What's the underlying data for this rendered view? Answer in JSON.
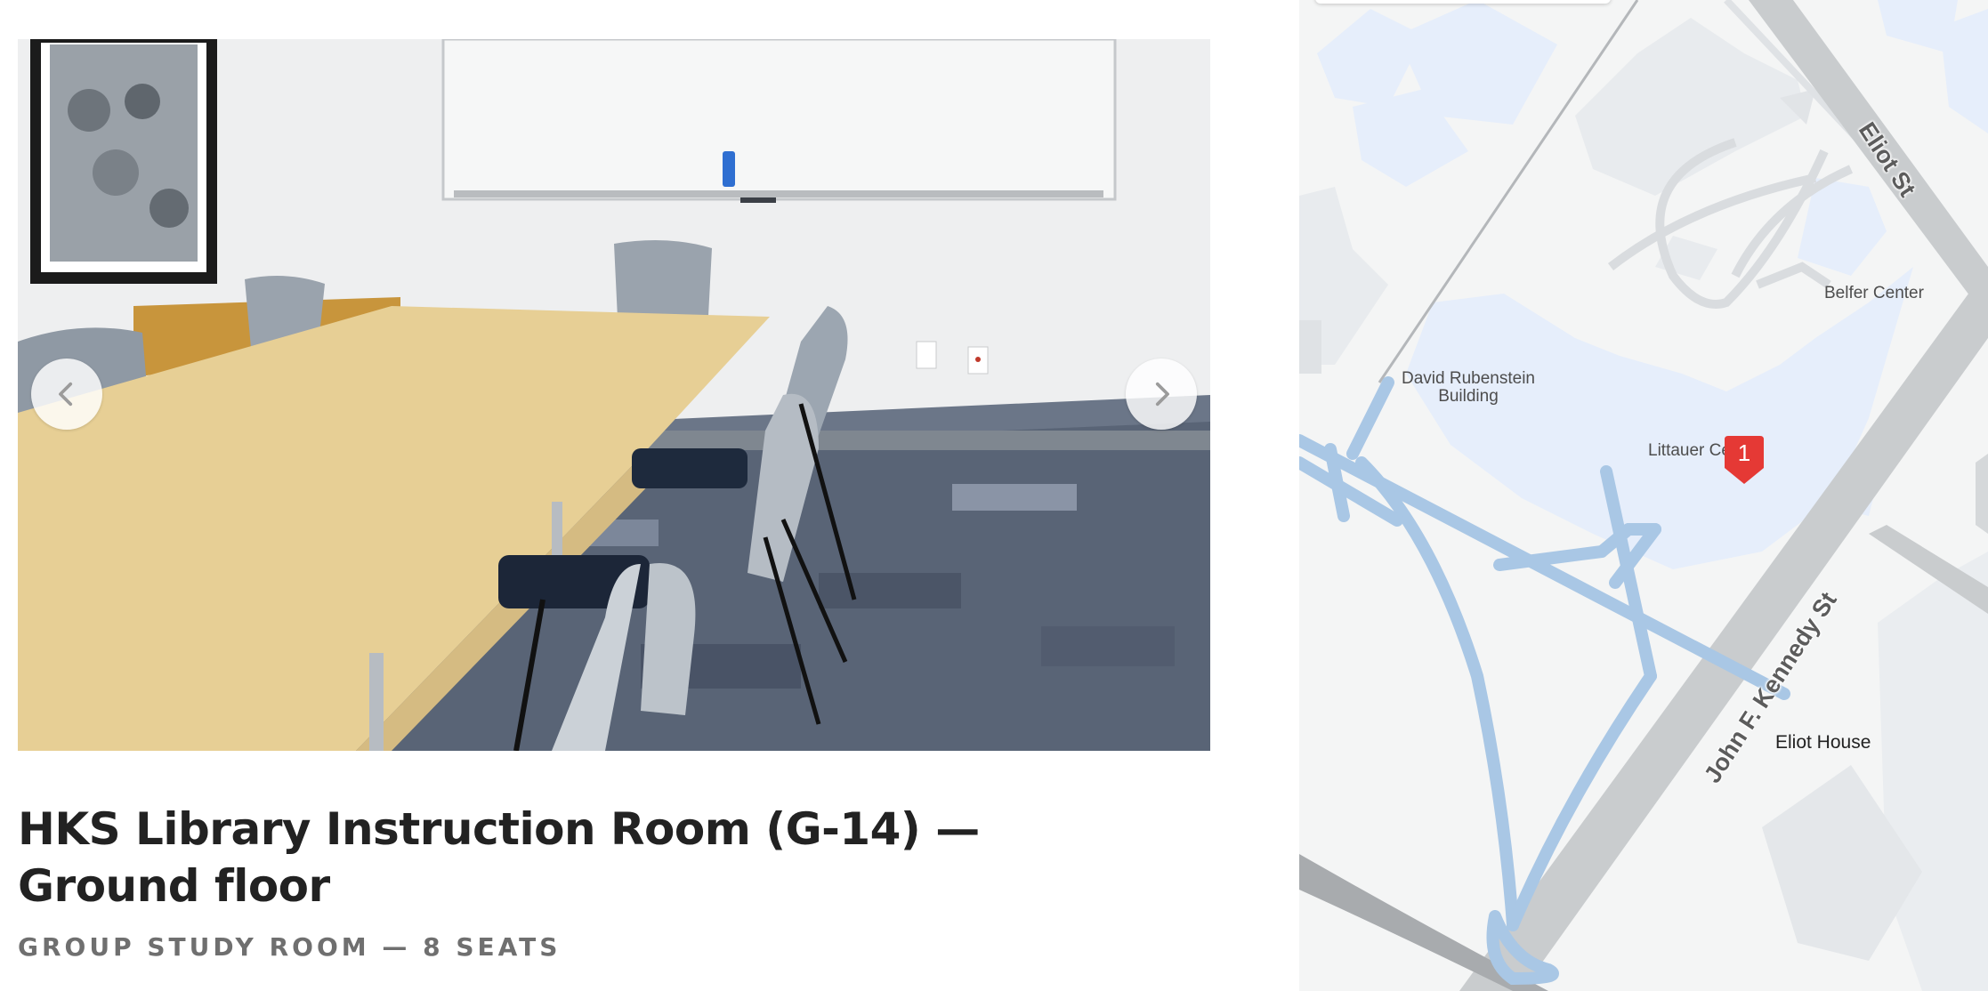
{
  "listing": {
    "title": "HKS Library Instruction Room (G-14) — Ground floor",
    "subtitle": "Group Study Room — 8 Seats"
  },
  "carousel": {
    "prev_icon": "chevron-left-icon",
    "next_icon": "chevron-right-icon"
  },
  "map": {
    "labels": {
      "belfer": "Belfer Center",
      "rubenstein": "David Rubenstein Building",
      "littauer": "Littauer Center",
      "eliot_house": "Eliot House"
    },
    "streets": {
      "eliot": "Eliot St",
      "jfk": "John F. Kennedy St"
    },
    "marker_number": "1",
    "colors": {
      "building": "#e6eefb",
      "path": "#a9c7e5",
      "road": "#c9ccce",
      "marker": "#e53935"
    }
  }
}
